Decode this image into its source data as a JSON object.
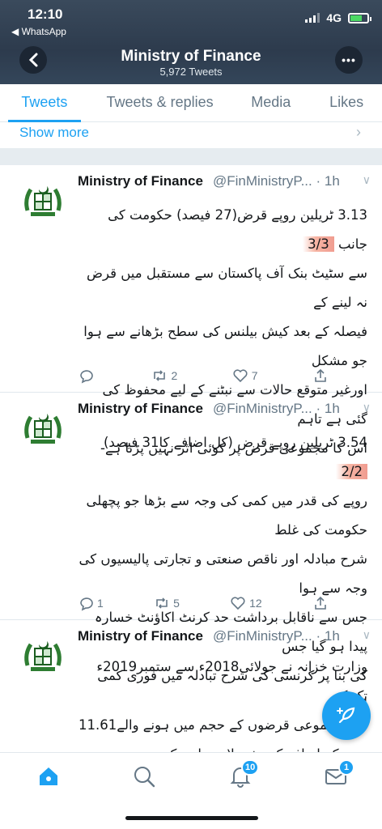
{
  "status": {
    "time": "12:10",
    "back_app": "◀ WhatsApp",
    "network": "4G"
  },
  "header": {
    "title": "Ministry of Finance",
    "subtitle": "5,972 Tweets"
  },
  "tabs": [
    {
      "label": "Tweets",
      "active": true
    },
    {
      "label": "Tweets & replies",
      "active": false
    },
    {
      "label": "Media",
      "active": false
    },
    {
      "label": "Likes",
      "active": false
    }
  ],
  "show_more": "Show more",
  "tweets": [
    {
      "name": "Ministry of Finance",
      "handle": "@FinMinistryP...",
      "time": "· 1h",
      "thread": "3/3",
      "lines": [
        "3.13 ٹریلین روپے قرض(27 فیصد) حکومت کی جانب",
        "سے سٹیٹ بنک آف پاکستان سے مستقبل میں قرض نہ لینے کے",
        "فیصلہ کے بعد کیش بیلنس کی سطح بڑھانے سے ہوا جو مشکل",
        "اورغیر متوقع حالات سے نبٹنے کے لیے محفوظ کی گئی ہے تاہم",
        "اس کا مجموعی قرض پر کوئی اثر نہیں پڑتا ہے-"
      ],
      "replies": "",
      "retweets": "2",
      "likes": "7"
    },
    {
      "name": "Ministry of Finance",
      "handle": "@FinMinistryP...",
      "time": "· 1h",
      "thread": "2/2",
      "lines": [
        "3.54 ٹریلین روپے قرض (کل اضافے کا31 فیصد)",
        "روپے کی قدر میں کمی کی وجہ سے بڑھا جو پچھلی حکومت کی غلط",
        "شرح مبادلہ اور ناقص صنعتی و تجارتی پالیسیوں کی وجہ سے ہوا",
        "جس سے ناقابل برداشت حد کرنٹ اکاؤنٹ خسارہ پیدا ہو گیا جس",
        "کی بنا پر کرنسی کی شرح تبادلہ میں فوری کمی لانا پڑی"
      ],
      "replies": "1",
      "retweets": "5",
      "likes": "12"
    },
    {
      "name": "Ministry of Finance",
      "handle": "@FinMinistryP...",
      "time": "· 1h",
      "lines": [
        "وزارت خزانہ نے جولائی2018ء سے ستمبر2019ء تک کے",
        "مجموعی قرضوں کے حجم میں ہونے والے11.61",
        "روپے کے اضافہ کی تفصیلات جاری کر دیں"
      ]
    }
  ],
  "tabbar": {
    "notifications_badge": "10",
    "messages_badge": "1"
  },
  "colors": {
    "accent": "#1da1f2",
    "header_bg": "#2d3b4d",
    "muted": "#657786"
  }
}
